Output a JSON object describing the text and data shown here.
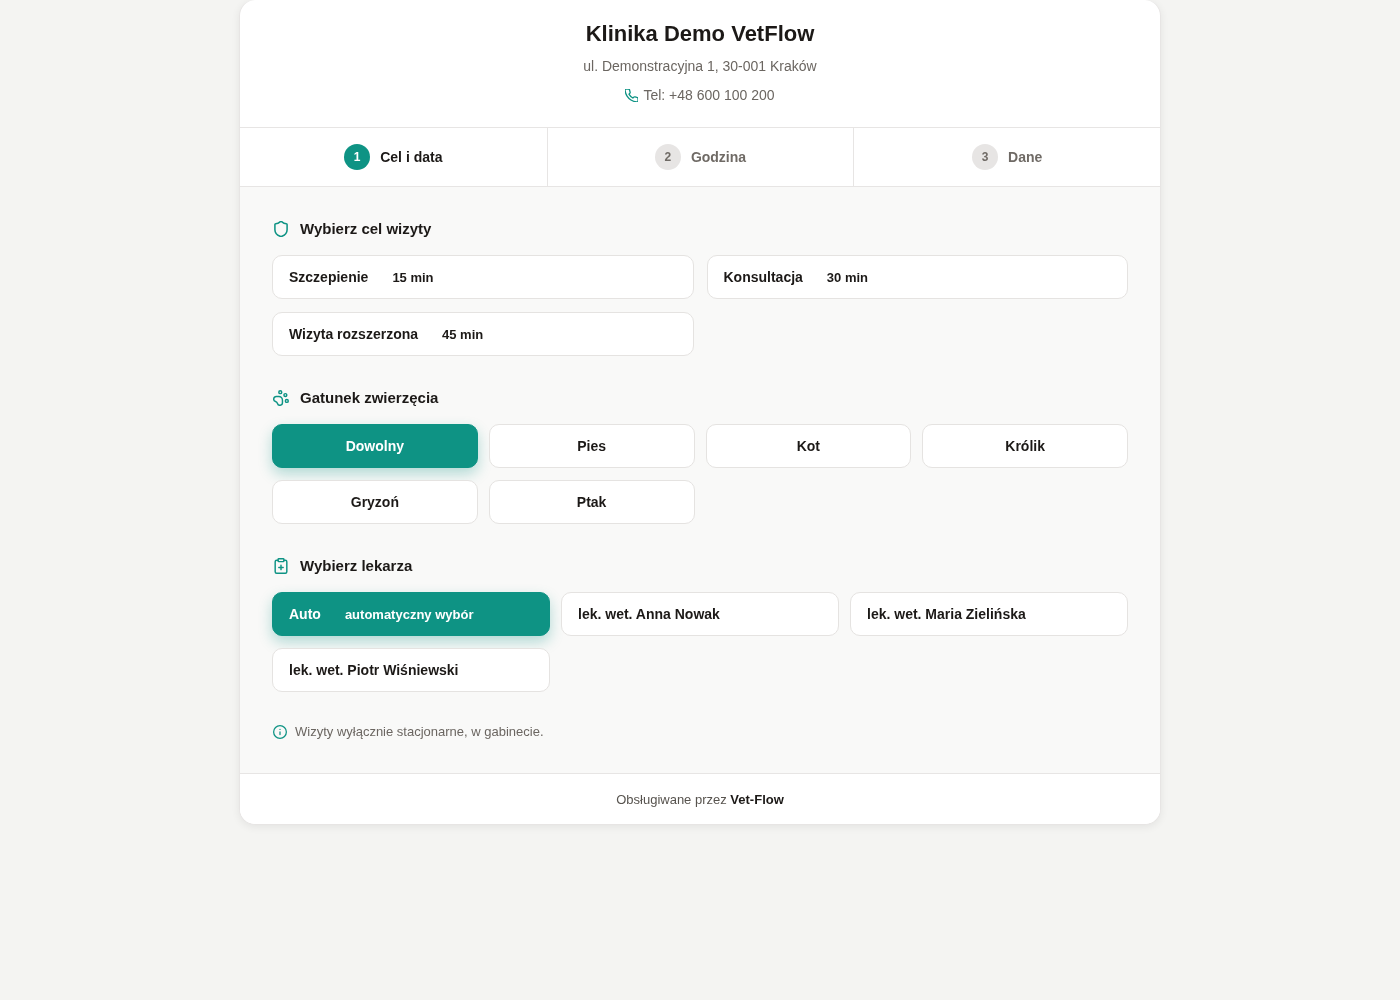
{
  "clinic": {
    "name": "Klinika Demo VetFlow",
    "address": "ul. Demonstracyjna 1, 30-001 Kraków",
    "phone": "Tel: +48 600 100 200"
  },
  "steps": [
    {
      "number": "1",
      "label": "Cel i data",
      "selected": true
    },
    {
      "number": "2",
      "label": "Godzina",
      "selected": false
    },
    {
      "number": "3",
      "label": "Dane",
      "selected": false
    }
  ],
  "purpose": {
    "title": "Wybierz cel wizyty",
    "options": [
      {
        "name": "Szczepienie",
        "duration": "15 min",
        "selected": false
      },
      {
        "name": "Konsultacja",
        "duration": "30 min",
        "selected": false
      },
      {
        "name": "Wizyta rozszerzona",
        "duration": "45 min",
        "selected": false
      }
    ]
  },
  "species": {
    "title": "Gatunek zwierzęcia",
    "options": [
      {
        "label": "Dowolny",
        "selected": true
      },
      {
        "label": "Pies",
        "selected": false
      },
      {
        "label": "Kot",
        "selected": false
      },
      {
        "label": "Królik",
        "selected": false
      },
      {
        "label": "Gryzoń",
        "selected": false
      },
      {
        "label": "Ptak",
        "selected": false
      }
    ]
  },
  "doctor": {
    "title": "Wybierz lekarza",
    "options": [
      {
        "name": "Auto",
        "note": "automatyczny wybór",
        "selected": true
      },
      {
        "name": "lek. wet. Anna Nowak",
        "selected": false
      },
      {
        "name": "lek. wet. Maria Zielińska",
        "selected": false
      },
      {
        "name": "lek. wet. Piotr Wiśniewski",
        "selected": false
      }
    ]
  },
  "notice": "Wizyty wyłącznie stacjonarne, w gabinecie.",
  "footer": "Obsługiwane przez **Vet-Flow**"
}
